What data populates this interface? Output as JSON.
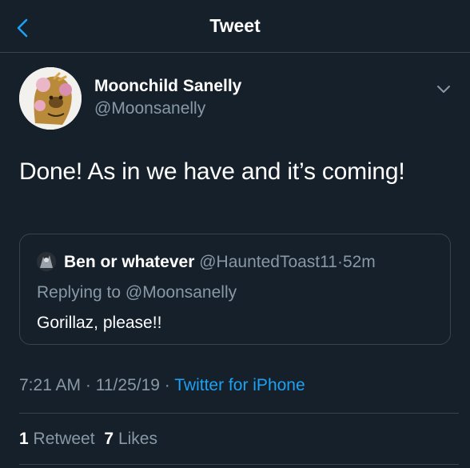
{
  "header": {
    "title": "Tweet",
    "back_icon": "chevron-left-icon"
  },
  "tweet": {
    "author_name": "Moonchild Sanelly",
    "author_handle": "@Moonsanelly",
    "text": "Done! As in we have and it’s coming!",
    "more_icon": "chevron-down-icon"
  },
  "quote": {
    "author_name": "Ben or whatever",
    "author_handle": "@HauntedToast11",
    "separator": "·",
    "time_ago": "52m",
    "replying_prefix": "Replying to",
    "replying_handle": "@Moonsanelly",
    "text": "Gorillaz, please!!"
  },
  "meta": {
    "time": "7:21 AM",
    "separator": "·",
    "date": "11/25/19",
    "source": "Twitter for iPhone"
  },
  "stats": {
    "retweets_count": "1",
    "retweets_label": "Retweet",
    "likes_count": "7",
    "likes_label": "Likes"
  },
  "colors": {
    "background": "#15202b",
    "text_primary": "#ffffff",
    "text_secondary": "#8899a6",
    "accent": "#1da1f2",
    "border": "#38444d"
  }
}
